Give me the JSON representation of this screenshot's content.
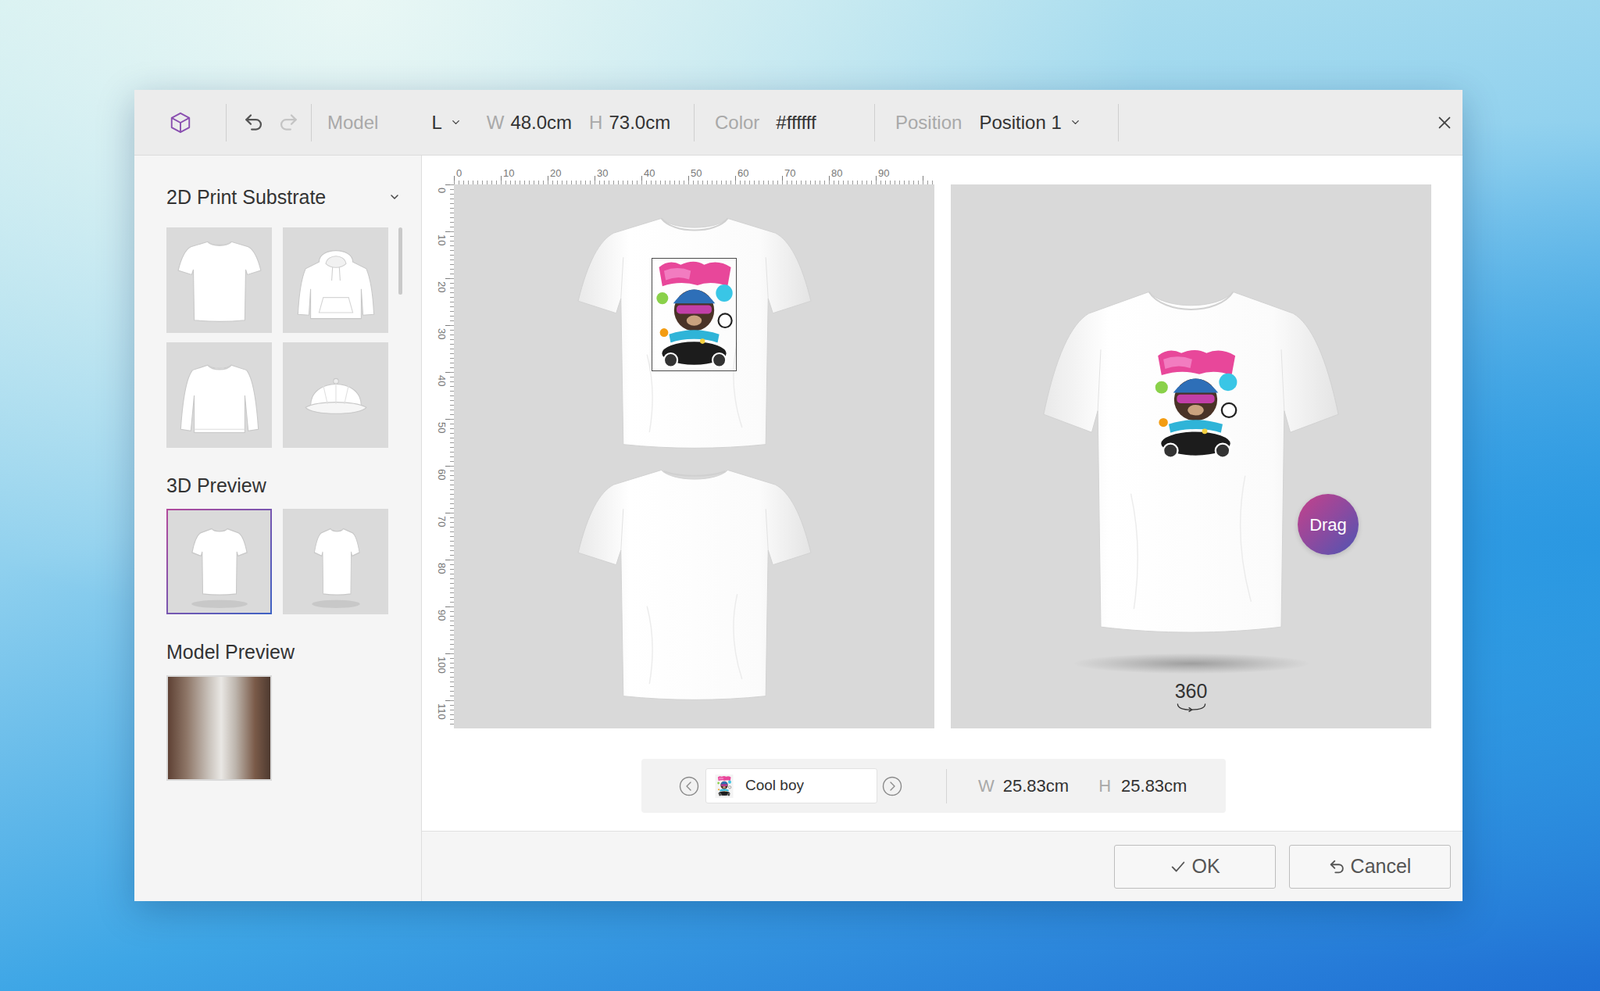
{
  "toolbar": {
    "model_label": "Model",
    "size": "L",
    "width_label": "W",
    "width": "48.0cm",
    "height_label": "H",
    "height": "73.0cm",
    "color_label": "Color",
    "color": "#ffffff",
    "position_label": "Position",
    "position": "Position 1"
  },
  "history": {
    "undo_enabled": true,
    "redo_enabled": false
  },
  "sidebar": {
    "sections": [
      {
        "title": "2D Print Substrate",
        "expanded": true,
        "items": [
          {
            "kind": "tshirt",
            "selected": false
          },
          {
            "kind": "hoodie",
            "selected": false
          },
          {
            "kind": "sweatshirt",
            "selected": false
          },
          {
            "kind": "cap",
            "selected": false
          }
        ]
      },
      {
        "title": "3D Preview",
        "items": [
          {
            "kind": "shirt-front",
            "selected": true
          },
          {
            "kind": "shirt-angle",
            "selected": false
          }
        ]
      },
      {
        "title": "Model Preview",
        "items": [
          {
            "kind": "photo",
            "selected": false
          }
        ]
      }
    ]
  },
  "canvas": {
    "ruler_x": [
      "0",
      "10",
      "20",
      "30",
      "40",
      "50",
      "60",
      "70",
      "80",
      "90"
    ],
    "ruler_y": [
      "0",
      "10",
      "20",
      "30",
      "40",
      "50",
      "60",
      "70",
      "80",
      "90",
      "100",
      "110"
    ],
    "views": [
      {
        "kind": "front",
        "has_design": true
      },
      {
        "kind": "back",
        "has_design": false
      }
    ]
  },
  "preview": {
    "rotate_label": "360",
    "drag_label": "Drag"
  },
  "layer": {
    "name": "Cool boy",
    "selected": true,
    "width_label": "W",
    "width": "25.83cm",
    "height_label": "H",
    "height": "25.83cm"
  },
  "buttons": [
    {
      "label": "OK",
      "kind": "ok"
    },
    {
      "label": "Cancel",
      "kind": "cancel"
    }
  ]
}
